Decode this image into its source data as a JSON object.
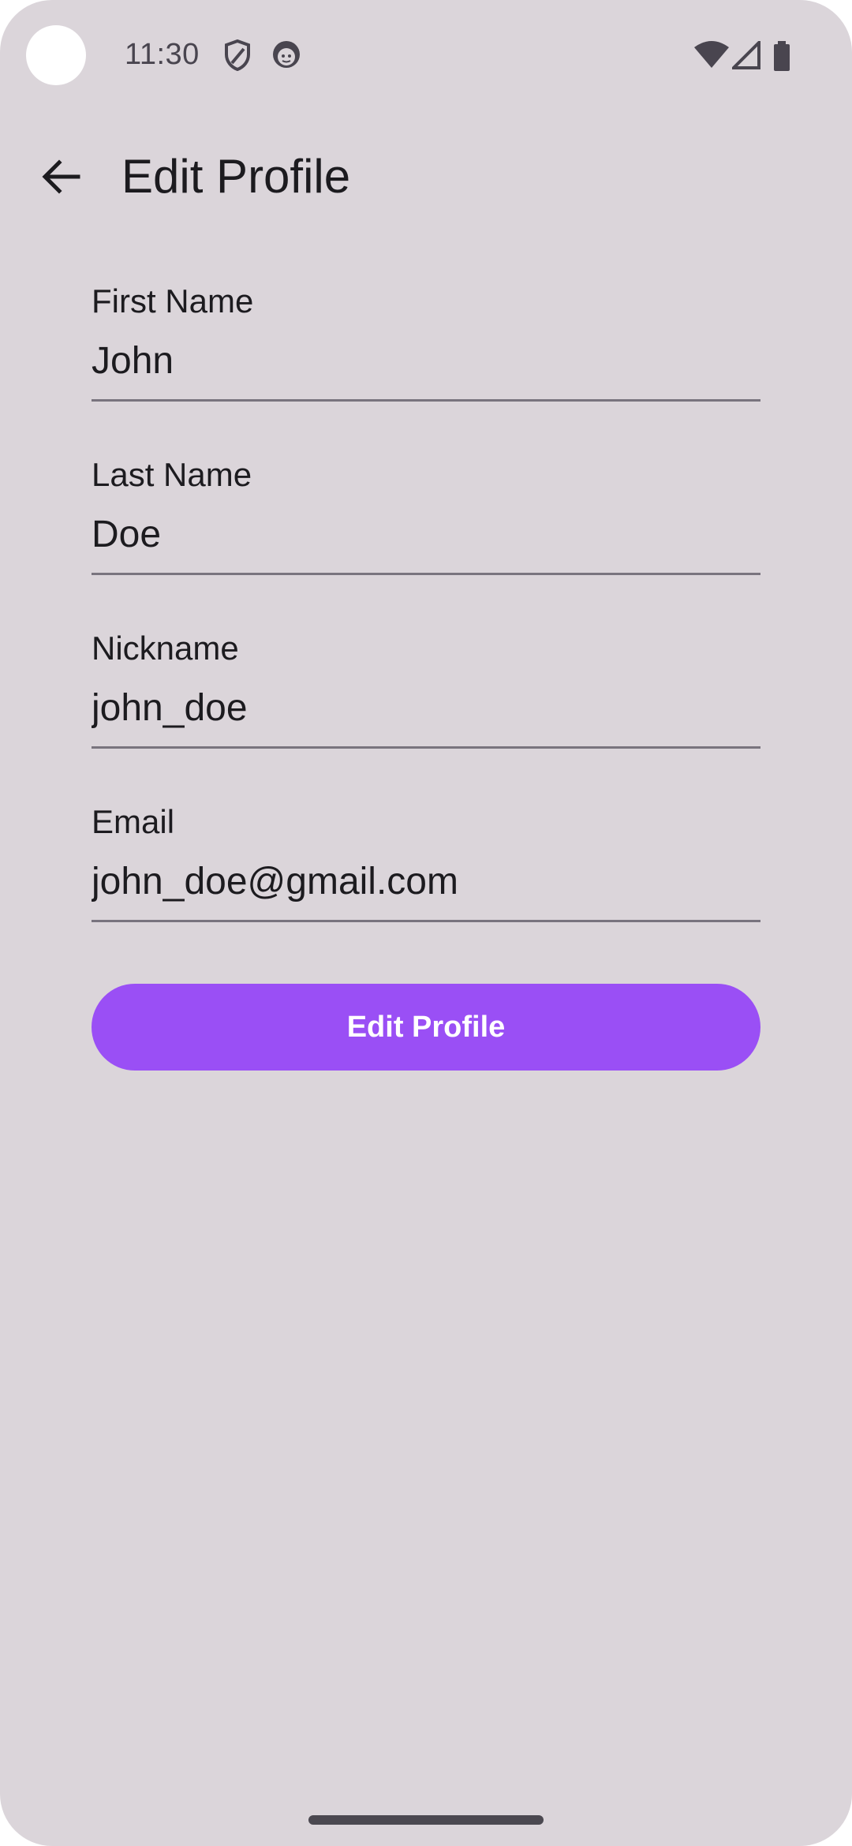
{
  "status_bar": {
    "time": "11:30",
    "left_icons": [
      "shield-icon",
      "face-icon"
    ],
    "right_icons": [
      "wifi-icon",
      "signal-icon",
      "battery-icon"
    ]
  },
  "app_bar": {
    "back_icon": "arrow-back-icon",
    "title": "Edit Profile"
  },
  "form": {
    "first_name": {
      "label": "First Name",
      "value": "John"
    },
    "last_name": {
      "label": "Last Name",
      "value": "Doe"
    },
    "nickname": {
      "label": "Nickname",
      "value": "john_doe"
    },
    "email": {
      "label": "Email",
      "value": "john_doe@gmail.com"
    }
  },
  "actions": {
    "submit_label": "Edit Profile"
  },
  "colors": {
    "background": "#dbd5da",
    "accent": "#9a4ff5",
    "text": "#1c1b1f",
    "underline": "#79747e"
  }
}
